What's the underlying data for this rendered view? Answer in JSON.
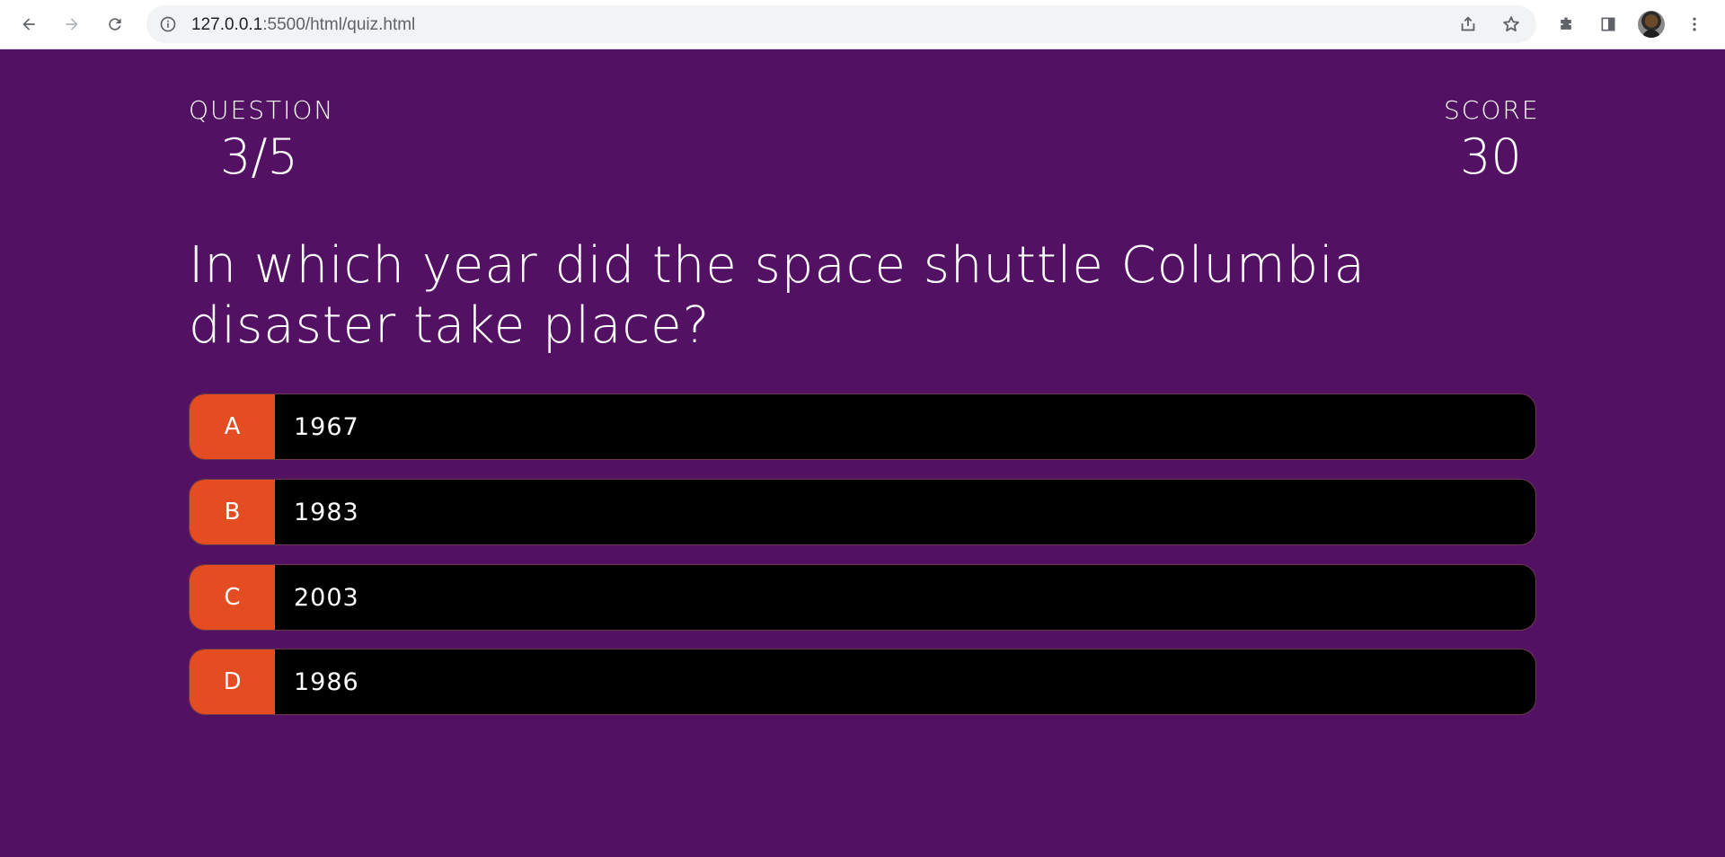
{
  "browser": {
    "url_host": "127.0.0.1",
    "url_path": ":5500/html/quiz.html",
    "icons": [
      "back-icon",
      "forward-icon",
      "reload-icon",
      "info-icon",
      "share-icon",
      "star-icon",
      "extensions-icon",
      "side-panel-icon",
      "avatar",
      "menu-icon"
    ]
  },
  "hud": {
    "question_label": "QUESTION",
    "question_progress": "3/5",
    "score_label": "SCORE",
    "score_value": "30"
  },
  "question": {
    "text": "In which year did the space shuttle Columbia disaster take place?"
  },
  "choices": [
    {
      "prefix": "A",
      "text": "1967"
    },
    {
      "prefix": "B",
      "text": "1983"
    },
    {
      "prefix": "C",
      "text": "2003"
    },
    {
      "prefix": "D",
      "text": "1986"
    }
  ],
  "colors": {
    "background": "#531163",
    "prefix": "#e44c22",
    "choice": "#000000",
    "text": "#ffffff"
  }
}
